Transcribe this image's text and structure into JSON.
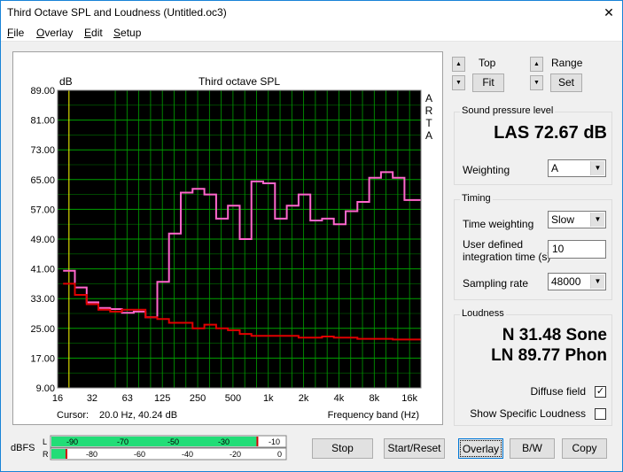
{
  "window": {
    "title": "Third Octave SPL and Loudness (Untitled.oc3)",
    "close_glyph": "✕"
  },
  "menu": [
    {
      "accel": "F",
      "rest": "ile"
    },
    {
      "accel": "O",
      "rest": "verlay"
    },
    {
      "accel": "E",
      "rest": "dit"
    },
    {
      "accel": "S",
      "rest": "etup"
    }
  ],
  "plot": {
    "unit_label": "dB",
    "title": "Third octave SPL",
    "side_letters": [
      "A",
      "R",
      "T",
      "A"
    ],
    "cursor_label": "Cursor:",
    "cursor_value": "20.0 Hz, 40.24 dB",
    "xaxis_label": "Frequency band (Hz)"
  },
  "chart_data": {
    "type": "line",
    "title": "Third octave SPL",
    "xlabel": "Frequency band (Hz)",
    "ylabel": "dB",
    "ylim": [
      9,
      89
    ],
    "x_scale": "log",
    "y_ticks": [
      "89.00",
      "81.00",
      "73.00",
      "65.00",
      "57.00",
      "49.00",
      "41.00",
      "33.00",
      "25.00",
      "17.00",
      "9.00"
    ],
    "x_ticks": [
      "16",
      "32",
      "63",
      "125",
      "250",
      "500",
      "1k",
      "2k",
      "4k",
      "8k",
      "16k"
    ],
    "grid": true,
    "background": "#000000",
    "grid_color": "#00a000",
    "cursor_color": "#ffff00",
    "cursor_x": 20,
    "bands": [
      "20",
      "25",
      "31.5",
      "40",
      "50",
      "63",
      "80",
      "100",
      "125",
      "160",
      "200",
      "250",
      "315",
      "400",
      "500",
      "630",
      "800",
      "1k",
      "1.25k",
      "1.6k",
      "2k",
      "2.5k",
      "3.15k",
      "4k",
      "5k",
      "6.3k",
      "8k",
      "10k",
      "12.5k",
      "16k",
      "20k"
    ],
    "series": [
      {
        "name": "",
        "color": "#ff66cc",
        "values": [
          40.5,
          36.0,
          32.0,
          30.5,
          30.2,
          29.2,
          29.5,
          28.0,
          37.5,
          50.5,
          61.5,
          62.5,
          61.0,
          54.5,
          58.0,
          49.0,
          64.5,
          64.0,
          54.5,
          58.0,
          61.0,
          54.0,
          54.5,
          53.0,
          56.5,
          59.0,
          65.5,
          67.0,
          65.5,
          59.5,
          59.5
        ]
      },
      {
        "name": "",
        "color": "#e00000",
        "values": [
          37.0,
          34.0,
          31.5,
          30.0,
          29.5,
          30.0,
          30.0,
          28.0,
          27.5,
          26.5,
          26.5,
          25.0,
          26.0,
          25.0,
          24.5,
          23.5,
          23.0,
          23.0,
          23.0,
          23.0,
          22.5,
          22.5,
          22.8,
          22.5,
          22.5,
          22.2,
          22.2,
          22.2,
          22.0,
          22.0,
          22.0
        ]
      }
    ]
  },
  "top_control": {
    "label": "Top",
    "button": "Fit"
  },
  "range_control": {
    "label": "Range",
    "button": "Set"
  },
  "spl_group": {
    "title": "Sound pressure level",
    "value": "LAS 72.67 dB",
    "weighting_label": "Weighting",
    "weighting_value": "A"
  },
  "timing_group": {
    "title": "Timing",
    "time_weighting_label": "Time weighting",
    "time_weighting_value": "Slow",
    "integration_label_1": "User defined",
    "integration_label_2": "integration time (s)",
    "integration_value": "10",
    "sampling_label": "Sampling rate",
    "sampling_value": "48000"
  },
  "loudness_group": {
    "title": "Loudness",
    "n_value": "N 31.48 Sone",
    "ln_value": "LN 89.77 Phon",
    "diffuse_label": "Diffuse field",
    "diffuse_checked": "✓",
    "specific_label": "Show Specific Loudness"
  },
  "meter": {
    "label": "dBFS",
    "left_channel": "L",
    "right_channel": "R",
    "left_ticks": [
      "-90",
      "-70",
      "-50",
      "-30",
      "-10"
    ],
    "right_ticks": [
      "-80",
      "-60",
      "-40",
      "-20",
      "0"
    ],
    "left_level_fraction": 0.87,
    "right_level_fraction": 0.06,
    "fill_color": "#22dd77"
  },
  "buttons": {
    "stop": "Stop",
    "start_reset": "Start/Reset",
    "overlay": "Overlay",
    "bw": "B/W",
    "copy": "Copy"
  }
}
